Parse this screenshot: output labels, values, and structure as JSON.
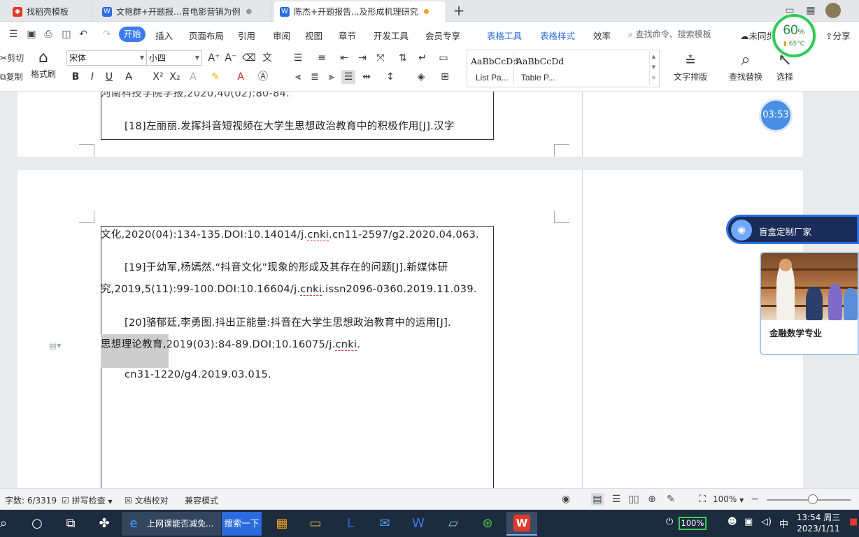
{
  "tabs": [
    {
      "label": "找稻壳模板"
    },
    {
      "label": "文艳群+开题报...音电影营销为例"
    },
    {
      "label": "陈杰+开题报告...及形成机理研究"
    }
  ],
  "menu": {
    "start": "开始",
    "items": [
      "插入",
      "页面布局",
      "引用",
      "审阅",
      "视图",
      "章节",
      "开发工具",
      "会员专享"
    ],
    "table_tools": "表格工具",
    "table_style": "表格样式",
    "efficiency": "效率",
    "search_placeholder": "查找命令、搜索模板",
    "sync": "未同步",
    "share": "分享"
  },
  "ribbon": {
    "cut": "剪切",
    "copy": "复制",
    "format_painter": "格式刷",
    "font_name": "宋体",
    "font_size": "小四",
    "styles": [
      {
        "sample": "AaBbCcDd",
        "name": "List Pa..."
      },
      {
        "sample": "AaBbCcDd",
        "name": "Table P..."
      }
    ],
    "text_layout": "文字排版",
    "find_replace": "查找替换",
    "select": "选择"
  },
  "document": {
    "page1_lines": [
      "河南科技学院学报,2020,40(02):80-84.",
      "[18]左丽丽.发挥抖音短视频在大学生思想政治教育中的积极作用[J].汉字"
    ],
    "ref_line0": "文化,2020(04):134-135.DOI:10.14014/j.",
    "ref_line0_cnki": "cnki",
    "ref_line0_tail": ".cn11-2597/g2.2020.04.063.",
    "ref19_a": "[19]于幼军,杨嫣然.“抖音文化”现象的形成及其存在的问题[J].新媒体研",
    "ref19_b": "究,2019,5(11):99-100.DOI:10.16604/j.",
    "ref19_b_cnki": "cnki",
    "ref19_b_tail": ".issn2096-0360.2019.11.039.",
    "ref20_a": "[20]骆郁廷,李勇图.抖出正能量:抖音在大学生思想政治教育中的运用[J].",
    "ref20_b_sel": "思想理论教育",
    "ref20_b": ",2019(03):84-89.DOI:10.16075/j.",
    "ref20_b_cnki": "cnki",
    "ref20_b_tail": ".",
    "ref20_c": "cn31-1220/g4.2019.03.015."
  },
  "widgets": {
    "perf_percent": "60",
    "perf_percent_unit": "%",
    "perf_temp": "65°C",
    "timer": "03:53",
    "ad_banner": "盲盒定制厂家",
    "ad_caption": "金融数学专业"
  },
  "status": {
    "word_count": "字数: 6/3319",
    "spell_check": "拼写检查",
    "doc_proof": "文档校对",
    "compat_mode": "兼容模式",
    "zoom": "100%",
    "zoom_fraction": 0.55
  },
  "taskbar": {
    "ie_label": "上网课能否减免...",
    "search_btn": "搜索一下",
    "battery": "100%",
    "ime": "中",
    "time": "13:54 周三",
    "date": "2023/1/11"
  },
  "colors": {
    "accent": "#3b7cf0",
    "wps_red": "#e03a2a",
    "perf_green": "#31c957"
  }
}
